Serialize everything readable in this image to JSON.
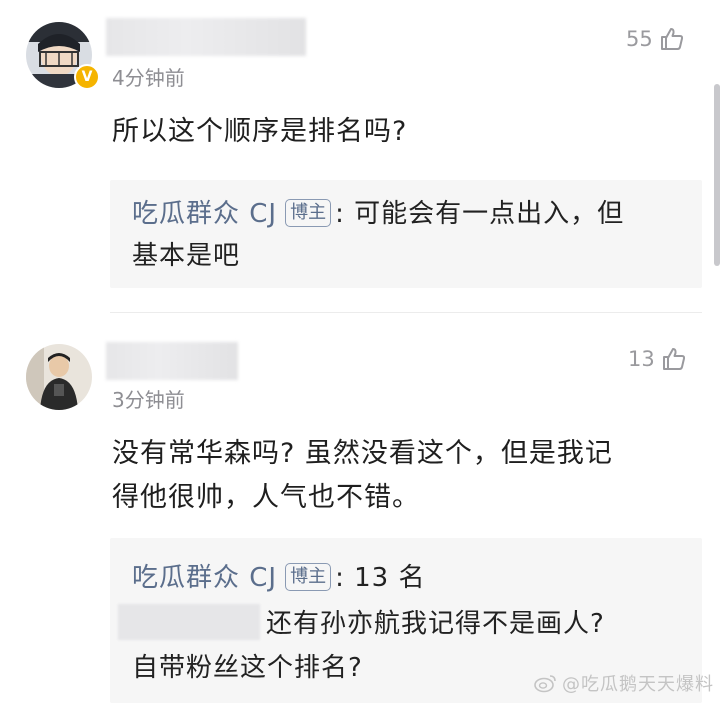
{
  "comments": [
    {
      "time": "4分钟前",
      "likes": "55",
      "text": "所以这个顺序是排名吗?",
      "reply": {
        "author": "吃瓜群众 CJ",
        "tag": "博主",
        "line1_rest": ": 可能会有一点出入，但",
        "line2": "基本是吧"
      }
    },
    {
      "time": "3分钟前",
      "likes": "13",
      "text_line1": "没有常华森吗? 虽然没看这个，但是我记",
      "text_line2": "得他很帅，人气也不错。",
      "reply": {
        "author": "吃瓜群众 CJ",
        "tag": "博主",
        "line1_rest": ": 13 名",
        "line2": "还有孙亦航我记得不是画人?",
        "line3": "自带粉丝这个排名?"
      }
    }
  ],
  "watermark": "@吃瓜鹅天天爆料",
  "colors": {
    "author": "#5b6e8c",
    "reply_bg": "#f6f6f6",
    "meta": "#8e8e93",
    "verified_badge": "#f5b400"
  },
  "icons": {
    "like": "thumbs-up-icon",
    "verified": "verified-badge-icon",
    "watermark": "weibo-logo-icon"
  }
}
